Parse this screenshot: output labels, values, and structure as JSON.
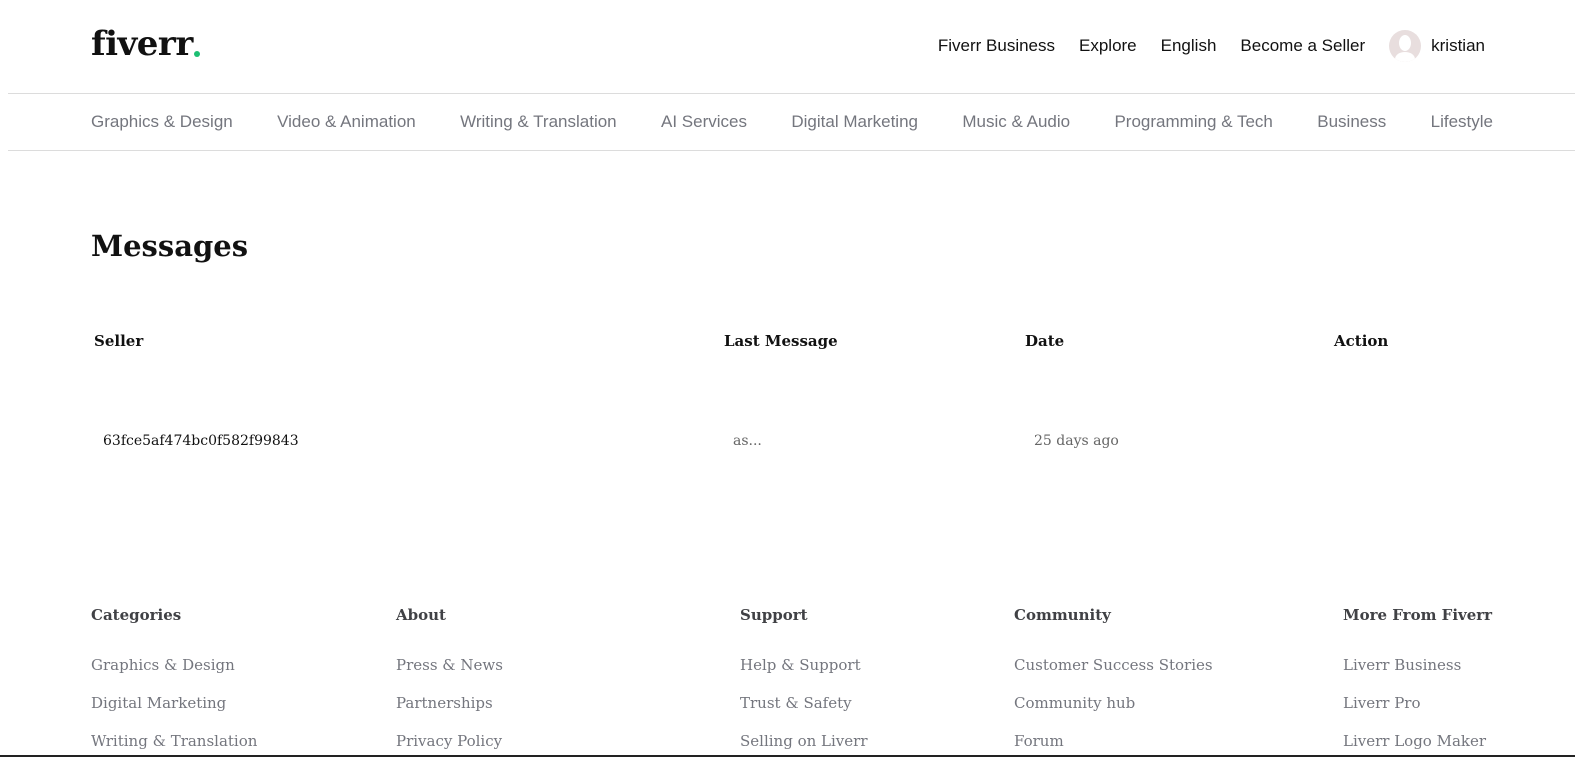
{
  "header": {
    "logo_text": "fiverr",
    "nav": [
      "Fiverr Business",
      "Explore",
      "English",
      "Become a Seller"
    ],
    "username": "kristian",
    "accent_color": "#1dbf73"
  },
  "categories": [
    "Graphics & Design",
    "Video & Animation",
    "Writing & Translation",
    "AI Services",
    "Digital Marketing",
    "Music & Audio",
    "Programming & Tech",
    "Business",
    "Lifestyle"
  ],
  "main": {
    "title": "Messages",
    "columns": {
      "seller": "Seller",
      "last_message": "Last Message",
      "date": "Date",
      "action": "Action"
    },
    "rows": [
      {
        "seller": "63fce5af474bc0f582f99843",
        "last_message": "as...",
        "date": "25 days ago",
        "action": ""
      }
    ]
  },
  "footer": {
    "columns": [
      {
        "title": "Categories",
        "links": [
          "Graphics & Design",
          "Digital Marketing",
          "Writing & Translation"
        ]
      },
      {
        "title": "About",
        "links": [
          "Press & News",
          "Partnerships",
          "Privacy Policy"
        ]
      },
      {
        "title": "Support",
        "links": [
          "Help & Support",
          "Trust & Safety",
          "Selling on Liverr"
        ]
      },
      {
        "title": "Community",
        "links": [
          "Customer Success Stories",
          "Community hub",
          "Forum"
        ]
      },
      {
        "title": "More From Fiverr",
        "links": [
          "Liverr Business",
          "Liverr Pro",
          "Liverr Logo Maker"
        ]
      }
    ]
  }
}
